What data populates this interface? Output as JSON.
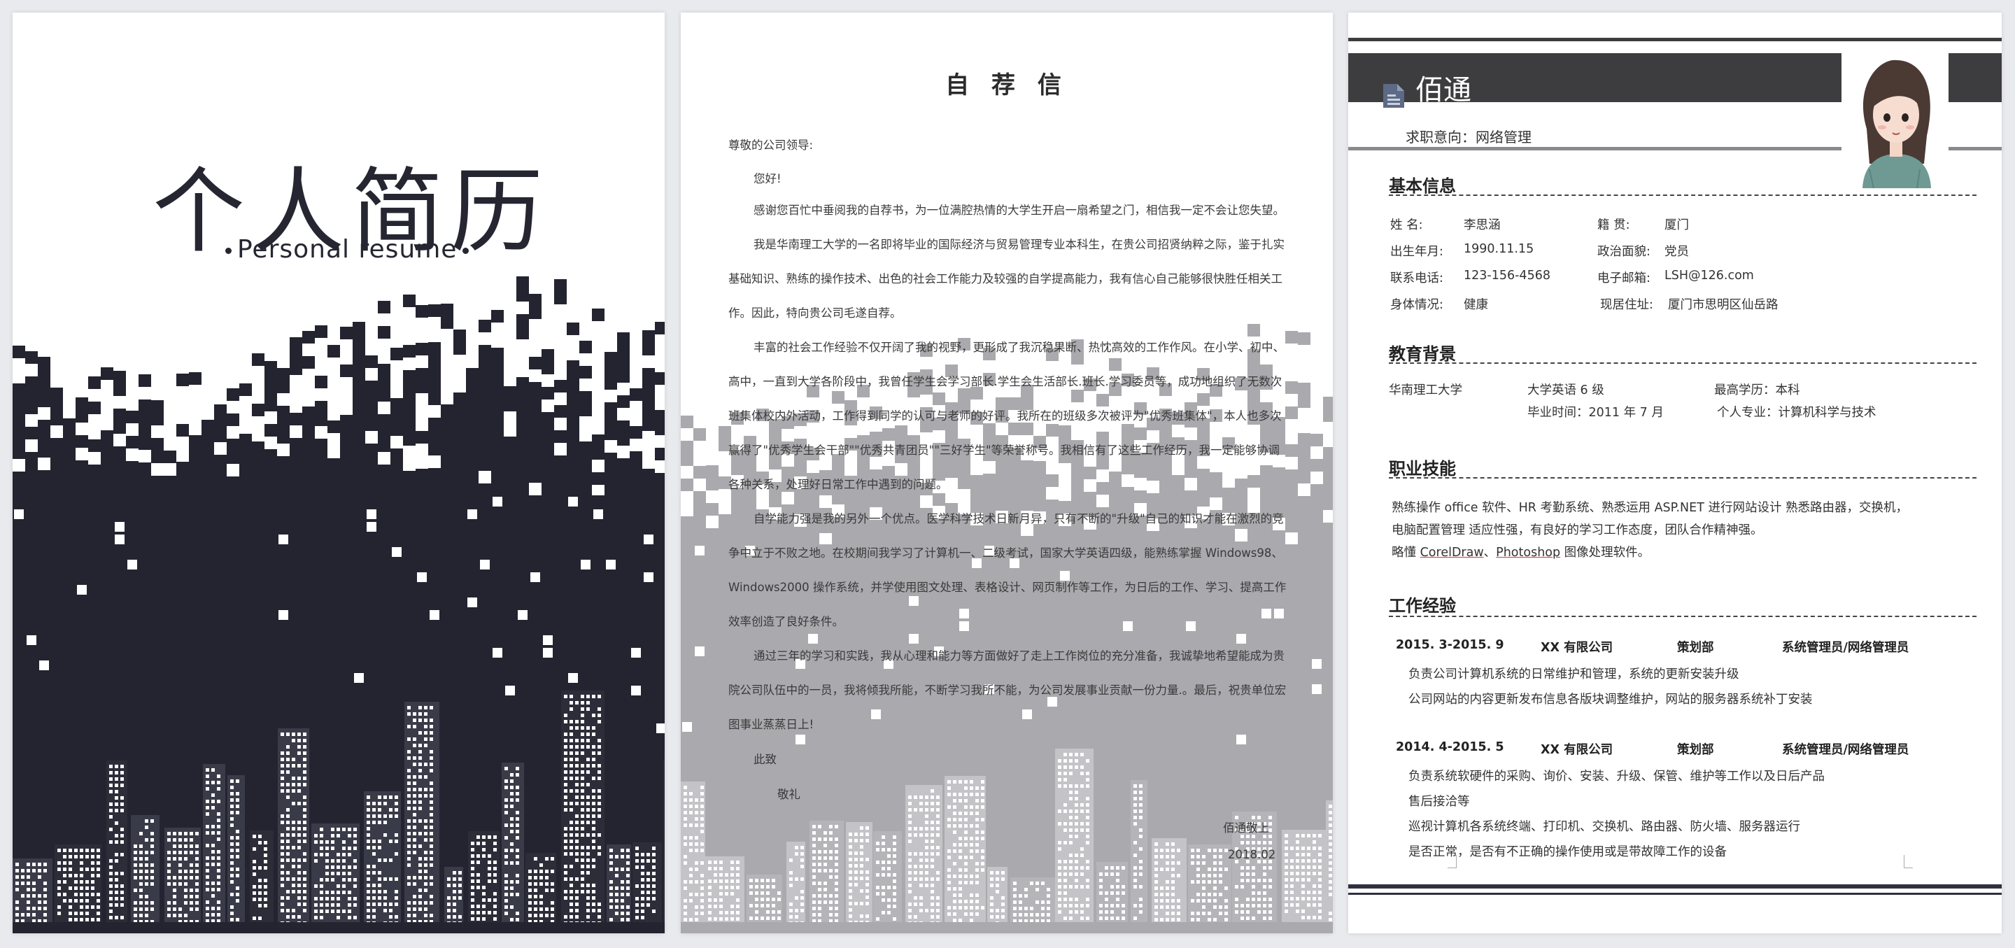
{
  "cover": {
    "title": "个人简历",
    "subtitle": "Personal resume"
  },
  "letter": {
    "title": "自 荐 信",
    "salutation": "尊敬的公司领导:",
    "greeting": "您好!",
    "paragraphs": [
      "感谢您百忙中垂阅我的自荐书，为一位满腔热情的大学生开启一扇希望之门，相信我一定不会让您失望。",
      "我是华南理工大学的一名即将毕业的国际经济与贸易管理专业本科生，在贵公司招贤纳粹之际，鉴于扎实基础知识、熟练的操作技术、出色的社会工作能力及较强的自学提高能力，我有信心自己能够很快胜任相关工作。因此，特向贵公司毛遂自荐。",
      "丰富的社会工作经验不仅开阔了我的视野，更形成了我沉稳果断、热忱高效的工作作风。在小学、初中、高中，一直到大学各阶段中，我曾任学生会学习部长.学生会生活部长.班长.学习委员等，成功地组织了无数次班集体校内外活动，工作得到同学的认可与老师的好评。我所在的班级多次被评为\"优秀班集体\"，本人也多次赢得了\"优秀学生会干部\"\"优秀共青团员\"\"三好学生\"等荣誉称号。我相信有了这些工作经历，我一定能够协调各种关系，处理好日常工作中遇到的问题。",
      "自学能力强是我的另外一个优点。医学科学技术日新月异，只有不断的\"升级\"自己的知识才能在激烈的竞争中立于不败之地。在校期间我学习了计算机一、二级考试，国家大学英语四级，能熟练掌握 Windows98、Windows2000 操作系统，并学使用图文处理、表格设计、网页制作等工作，为日后的工作、学习、提高工作效率创造了良好条件。",
      "通过三年的学习和实践，我从心理和能力等方面做好了走上工作岗位的充分准备，我诚挚地希望能成为贵院公司队伍中的一员，我将倾我所能，不断学习我所不能，为公司发展事业贡献一份力量.。最后，祝贵单位宏图事业蒸蒸日上!"
    ],
    "closing1": "此致",
    "closing2": "敬礼",
    "signature": "佰通敬上",
    "date": "2018.02"
  },
  "resume": {
    "name": "佰通",
    "intent_label": "求职意向：",
    "intent_value": "网络管理",
    "sections": {
      "basic": "基本信息",
      "education": "教育背景",
      "skills": "职业技能",
      "experience": "工作经验"
    },
    "basic_info": [
      {
        "label": "姓      名:",
        "value": "李思涵"
      },
      {
        "label": "籍      贯:",
        "value": "厦门"
      },
      {
        "label": "出生年月:",
        "value": "1990.11.15"
      },
      {
        "label": "政治面貌:",
        "value": "党员"
      },
      {
        "label": "联系电话:",
        "value": "123-156-4568"
      },
      {
        "label": "电子邮箱:",
        "value": "LSH@126.com"
      },
      {
        "label": "身体情况:",
        "value": "健康"
      },
      {
        "label": "现居住址:",
        "value": "厦门市思明区仙岳路"
      }
    ],
    "education": {
      "school": "华南理工大学",
      "english": "大学英语 6 级",
      "degree": "最高学历：本科",
      "grad": "毕业时间：2011 年 7 月",
      "major": "个人专业：计算机科学与技术"
    },
    "skills": {
      "line1": "熟练操作 office 软件、HR 考勤系统、熟悉运用 ASP.NET 进行网站设计   熟悉路由器，交换机，",
      "line2": "电脑配置管理   适应性强，有良好的学习工作态度，团队合作精神强。",
      "line3_pre": "略懂 ",
      "line3_a": "CorelDraw",
      "line3_sep": "、",
      "line3_b": "Photoshop",
      "line3_post": " 图像处理软件。"
    },
    "jobs": [
      {
        "period": "2015. 3-2015. 9",
        "company": "XX 有限公司",
        "dept": "策划部",
        "role": "系统管理员/网络管理员",
        "duties": [
          "负责公司计算机系统的日常维护和管理，系统的更新安装升级",
          "公司网站的内容更新发布信息各版块调整维护，网站的服务器系统补丁安装"
        ]
      },
      {
        "period": "2014. 4-2015. 5",
        "company": "XX 有限公司",
        "dept": "策划部",
        "role": "系统管理员/网络管理员",
        "duties": [
          "负责系统软硬件的采购、询价、安装、升级、保管、维护等工作以及日后产品",
          "售后接洽等",
          "巡视计算机各系统终端、打印机、交换机、路由器、防火墙、服务器运行",
          "是否正常，是否有不正确的操作使用或是带故障工作的设备"
        ]
      }
    ]
  },
  "colors": {
    "dark": "#252631",
    "gray": "#a9a9ae",
    "band": "#3d3d3f"
  }
}
